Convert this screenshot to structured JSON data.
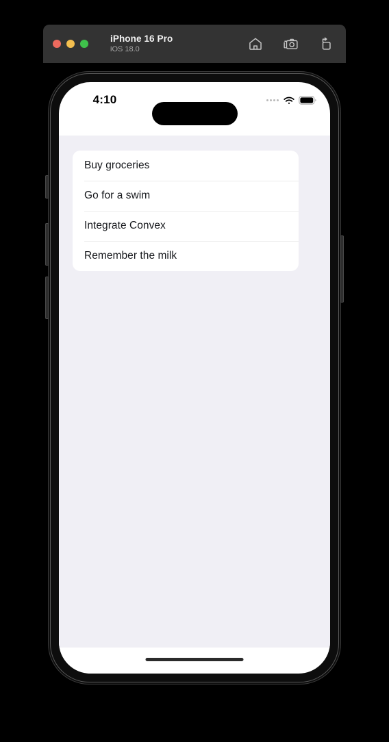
{
  "simulator": {
    "window_controls": [
      {
        "name": "close",
        "color": "#ed6a5e"
      },
      {
        "name": "minimize",
        "color": "#f4bf4f"
      },
      {
        "name": "maximize",
        "color": "#3fc14b"
      }
    ],
    "device_name": "iPhone 16 Pro",
    "os_version": "iOS 18.0",
    "toolbar": [
      {
        "icon": "home-icon",
        "label": "Home"
      },
      {
        "icon": "screenshot-camera-icon",
        "label": "Screenshot"
      },
      {
        "icon": "rotate-device-icon",
        "label": "Rotate"
      }
    ]
  },
  "status_bar": {
    "time": "4:10",
    "signal_icon": "cellular-dots-icon",
    "wifi_icon": "wifi-icon",
    "battery_icon": "battery-full-icon"
  },
  "app": {
    "background_color": "#f0eff5",
    "card_color": "#ffffff",
    "divider_color": "#ececec",
    "text_color": "#16181c",
    "todos": [
      {
        "label": "Buy groceries"
      },
      {
        "label": "Go for a swim"
      },
      {
        "label": "Integrate Convex"
      },
      {
        "label": "Remember the milk"
      }
    ]
  }
}
